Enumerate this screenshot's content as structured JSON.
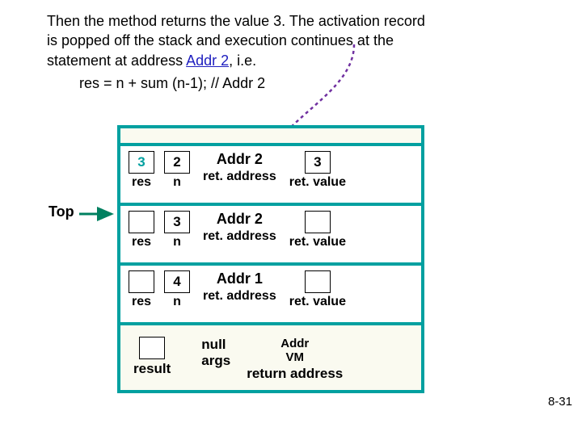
{
  "explain": {
    "line1a": "Then the method returns the value 3. The activation record",
    "line2": "is popped off the stack and execution continues at the",
    "line3a": "statement at address ",
    "addr2": "Addr 2",
    "line3b": ", i.e.",
    "code": "res = n + sum (n-1); // Addr 2"
  },
  "top_label": "Top",
  "labels": {
    "res": "res",
    "n": "n",
    "retaddr": "ret. address",
    "retval": "ret. value",
    "result": "result",
    "null": "null",
    "args": "args",
    "addrvm_l1": "Addr",
    "addrvm_l2": "VM",
    "return_address": "return address"
  },
  "rows": [
    {
      "res": "3",
      "n": "2",
      "addr": "Addr 2",
      "ret": "3"
    },
    {
      "res": "",
      "n": "3",
      "addr": "Addr 2",
      "ret": ""
    },
    {
      "res": "",
      "n": "4",
      "addr": "Addr 1",
      "ret": ""
    }
  ],
  "page": "8-31",
  "chart_data": {
    "type": "table",
    "title": "Call stack activation records during return of sum(n)",
    "columns": [
      "res",
      "n",
      "ret.address",
      "ret.value"
    ],
    "rows": [
      {
        "res": 3,
        "n": 2,
        "ret.address": "Addr 2",
        "ret.value": 3
      },
      {
        "res": null,
        "n": 3,
        "ret.address": "Addr 2",
        "ret.value": null
      },
      {
        "res": null,
        "n": 4,
        "ret.address": "Addr 1",
        "ret.value": null
      }
    ],
    "bottom_frame": {
      "result": null,
      "args": "null",
      "return_address": "Addr VM"
    },
    "top_pointer_row_index": 1
  }
}
